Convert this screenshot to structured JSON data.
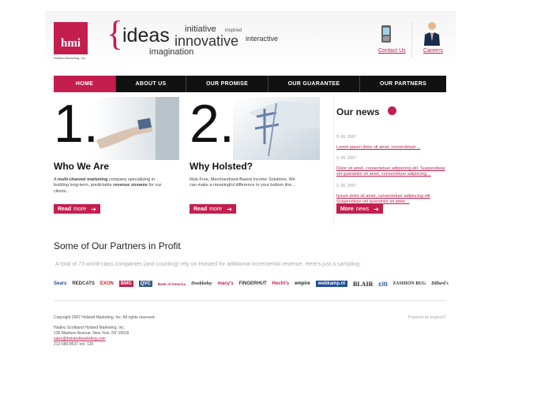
{
  "brand": {
    "logo_text": "hmi",
    "logo_sub": "Holsted Marketing, Inc."
  },
  "tagline": {
    "ideas": "ideas",
    "initiative": "initiative",
    "inspired": "inspired",
    "innovative": "innovative",
    "interactive": "interactive",
    "imagination": "imagination"
  },
  "header_links": {
    "contact": "Contact Us",
    "careers": "Careers"
  },
  "nav": {
    "items": [
      {
        "label": "HOME",
        "active": true
      },
      {
        "label": "ABOUT US",
        "active": false
      },
      {
        "label": "OUR PROMISE",
        "active": false
      },
      {
        "label": "OUR GUARANTEE",
        "active": false
      },
      {
        "label": "OUR PARTNERS",
        "active": false
      }
    ]
  },
  "features": [
    {
      "number": "1.",
      "title": "Who We Are",
      "text_a": "A ",
      "text_b": "multi-channel marketing",
      "text_c": " company specializing in building long-term, predictable ",
      "text_d": "revenue streams",
      "text_e": " for our clients…",
      "btn_read": "Read",
      "btn_more": "more"
    },
    {
      "number": "2.",
      "title": "Why Holsted?",
      "text_a": "Risk-Free, Merchandised-Based Income Solutions. We can make a meaningful difference to your bottom line…",
      "btn_read": "Read",
      "btn_more": "more"
    }
  ],
  "news": {
    "title": "Our news",
    "items": [
      {
        "date": "9. 06. 2007",
        "text": "Lorem ipsum dolor sit amet, consectetuer…"
      },
      {
        "date": "3. 06. 2007",
        "text": "Dolor sit amet, consectetuer adipiscing elit. Suspendisse vel quandolor sit amet, consectetuer adipiscing…"
      },
      {
        "date": "2. 06. 2007",
        "text": "Ipsum dolor sit amet, consectetuer adipiscing elit Suspendisse vel quandolor sit amet…"
      }
    ],
    "btn_more": "More",
    "btn_news": "news"
  },
  "partners": {
    "title": "Some of Our Partners in Profit",
    "subtitle": "A total of 73 world-class companies (and counting) rely on Holsted for additional incremental revenue. Here's just a sampling:",
    "logos": [
      "Sears",
      "REDCATS",
      "EXON",
      "BMG",
      "QVC",
      "Bank of America",
      "Doubleday",
      "macy's",
      "FINGERHUT",
      "Hecht's",
      "empire",
      "webkamp.nl",
      "BLAIR",
      "citi",
      "FASHION BUG",
      "Dillard's"
    ]
  },
  "footer": {
    "copyright": "Copyright 2007 Holsted Marketing, Inc. All rights reserved.",
    "powered": "Powered by engine37",
    "addr1": "Hadley Scottland Holsted Marketing, Inc.",
    "addr2": "135 Madison Avenue. New York, NY 10016",
    "email": "sales@holstedmarketing.com",
    "phone": "212-686-8537 ext. 120"
  },
  "colors": {
    "accent": "#c41e4e",
    "nav_bg": "#111111"
  }
}
